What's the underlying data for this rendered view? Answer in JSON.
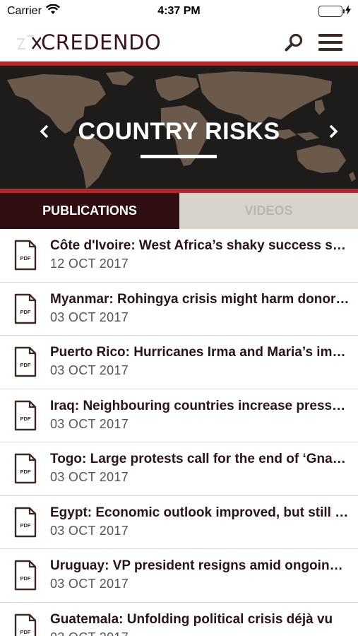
{
  "status_bar": {
    "carrier": "Carrier",
    "time": "4:37 PM",
    "battery_level": 1.0,
    "battery_color": "#4cd964"
  },
  "header": {
    "logo_text": "CREDENDO",
    "icons": [
      "search-icon",
      "menu-icon"
    ]
  },
  "banner": {
    "title": "COUNTRY RISKS",
    "accent_color": "#b2282c",
    "prev_icon": "chevron-left-icon",
    "next_icon": "chevron-right-icon"
  },
  "tabs": [
    {
      "label": "PUBLICATIONS",
      "active": true
    },
    {
      "label": "VIDEOS",
      "active": false
    }
  ],
  "publications": [
    {
      "title": "Côte d'Ivoire: West Africa’s shaky success story",
      "date": "12 OCT 2017",
      "icon": "pdf-icon"
    },
    {
      "title": "Myanmar: Rohingya crisis might harm donor support",
      "date": "03 OCT 2017",
      "icon": "pdf-icon"
    },
    {
      "title": "Puerto Rico: Hurricanes Irma and Maria’s impact",
      "date": "03 OCT 2017",
      "icon": "pdf-icon"
    },
    {
      "title": "Iraq: Neighbouring countries increase pressure",
      "date": "03 OCT 2017",
      "icon": "pdf-icon"
    },
    {
      "title": "Togo: Large protests call for the end of ‘Gnassingbé’",
      "date": "03 OCT 2017",
      "icon": "pdf-icon"
    },
    {
      "title": "Egypt: Economic outlook improved, but still fragile",
      "date": "03 OCT 2017",
      "icon": "pdf-icon"
    },
    {
      "title": "Uruguay: VP president resigns amid ongoing scandal",
      "date": "03 OCT 2017",
      "icon": "pdf-icon"
    },
    {
      "title": "Guatemala: Unfolding political crisis déjà vu",
      "date": "03 OCT 2017",
      "icon": "pdf-icon"
    }
  ]
}
